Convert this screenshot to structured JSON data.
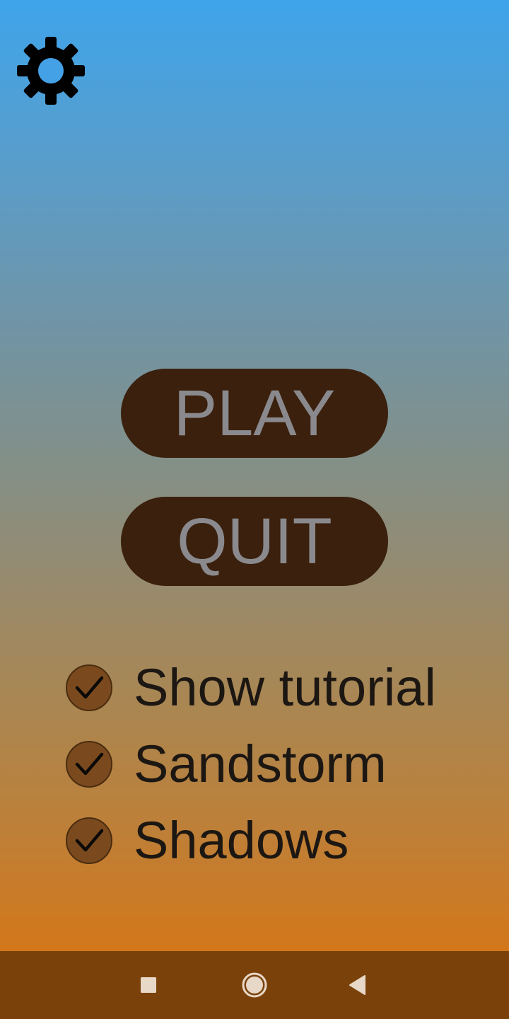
{
  "menu": {
    "play_label": "PLAY",
    "quit_label": "QUIT"
  },
  "options": [
    {
      "label": "Show tutorial",
      "checked": true
    },
    {
      "label": "Sandstorm",
      "checked": true
    },
    {
      "label": "Shadows",
      "checked": true
    }
  ],
  "icons": {
    "settings": "gear-icon",
    "checkbox": "checkmark-icon",
    "nav_recents": "square-icon",
    "nav_home": "circle-icon",
    "nav_back": "triangle-back-icon"
  },
  "colors": {
    "sky_top": "#3fa4ea",
    "sand_bottom": "#d3771a",
    "button_bg": "#3a200d",
    "button_text": "#8a8a8e",
    "checkbox_fill": "#7a4a1e",
    "label_text": "#1c1712",
    "nav_bar": "#7a420a",
    "nav_icons": "#e8d8c8"
  }
}
